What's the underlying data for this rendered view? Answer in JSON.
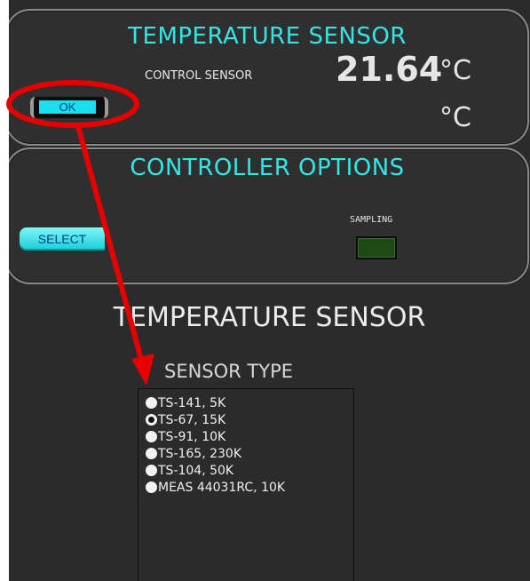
{
  "panel_top": {
    "title": "TEMPERATURE SENSOR",
    "control_label": "CONTROL SENSOR",
    "value": "21.64",
    "unit_primary": "°C",
    "unit_secondary": "°C",
    "ok_button": "OK"
  },
  "panel_options": {
    "title": "CONTROLLER OPTIONS",
    "select_button": "SELECT",
    "sampling_label": "SAMPLING"
  },
  "sensor_section": {
    "heading": "TEMPERATURE SENSOR",
    "type_label": "SENSOR TYPE",
    "options": [
      {
        "label": "TS-141, 5K",
        "selected": false
      },
      {
        "label": "TS-67, 15K",
        "selected": true
      },
      {
        "label": "TS-91, 10K",
        "selected": false
      },
      {
        "label": "TS-165, 230K",
        "selected": false
      },
      {
        "label": "TS-104, 50K",
        "selected": false
      },
      {
        "label": "MEAS 44031RC, 10K",
        "selected": false
      }
    ]
  },
  "colors": {
    "accent": "#33e6e6",
    "annotation": "#e60000",
    "background": "#2b2b2b"
  }
}
